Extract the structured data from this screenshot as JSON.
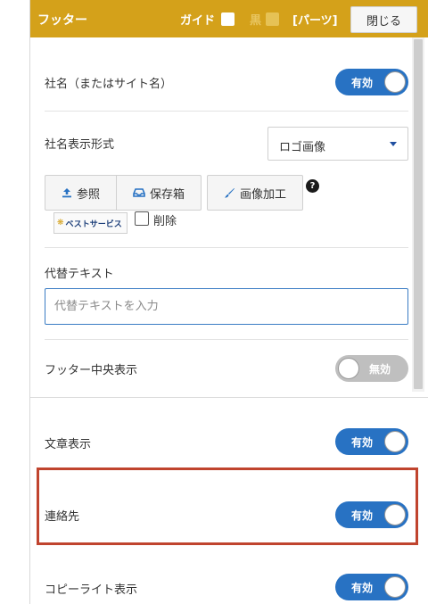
{
  "header": {
    "title": "フッター",
    "guide_label": "ガイド",
    "black_label": "黒",
    "parts_label": "[パーツ]",
    "close_label": "閉じる"
  },
  "fields": {
    "company_name": {
      "label": "社名（またはサイト名）",
      "toggle": "有効",
      "state": "on"
    },
    "display_format": {
      "label": "社名表示形式",
      "selected": "ロゴ画像"
    },
    "buttons": {
      "browse": "参照",
      "storage": "保存箱",
      "edit_image": "画像加工",
      "help": "?"
    },
    "logo": {
      "text": "ベストサービス",
      "delete_label": "削除"
    },
    "alt_text": {
      "label": "代替テキスト",
      "placeholder": "代替テキストを入力"
    },
    "footer_center": {
      "label": "フッター中央表示",
      "toggle": "無効",
      "state": "off"
    },
    "text_display": {
      "label": "文章表示",
      "toggle": "有効",
      "state": "on"
    },
    "contact": {
      "label": "連絡先",
      "toggle": "有効",
      "state": "on"
    },
    "copyright": {
      "label": "コピーライト表示",
      "toggle": "有効",
      "state": "on"
    }
  },
  "colors": {
    "header_bg": "#d4a11a",
    "toggle_on": "#2872c3",
    "toggle_off": "#bfbfbf",
    "highlight": "#c0442e"
  }
}
